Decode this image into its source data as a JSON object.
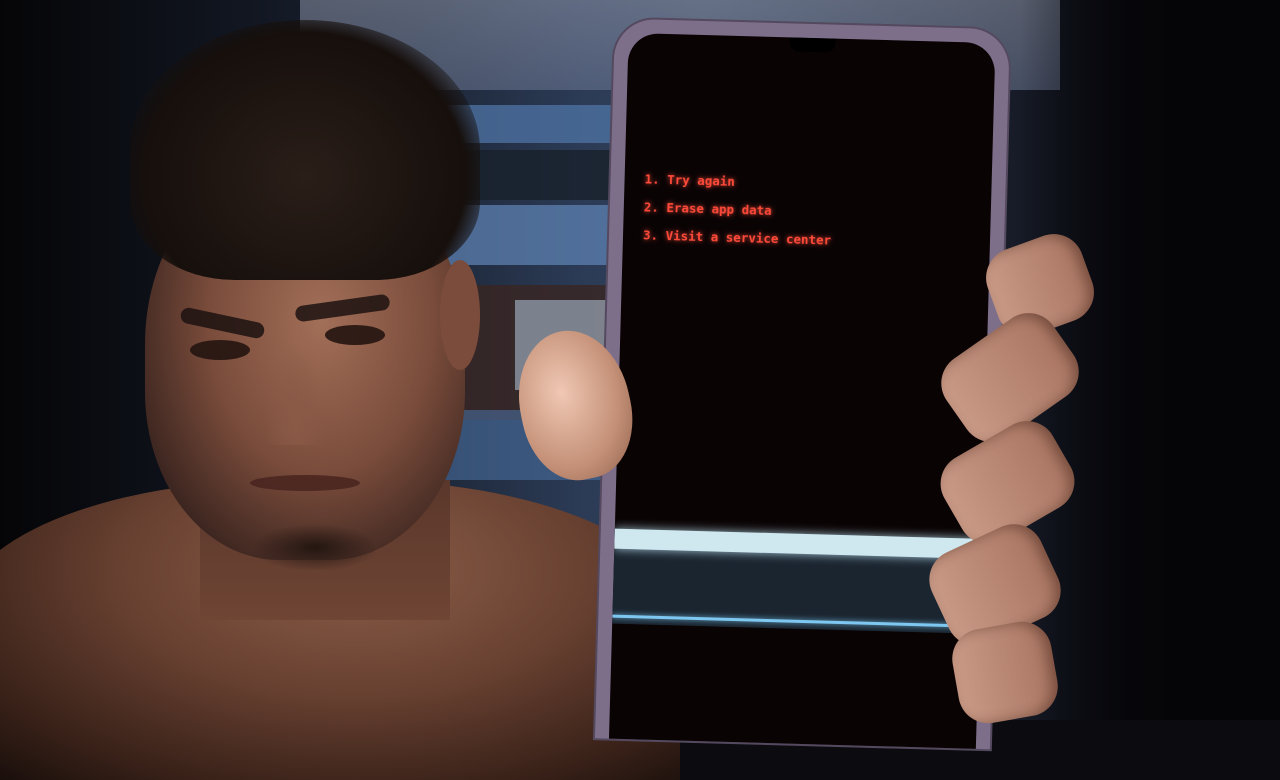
{
  "photo": {
    "subject": "",
    "device_screen": {
      "header_lines": [
        "",
        ""
      ],
      "body_intro": "",
      "steps": [
        {
          "title": "1. Try again",
          "text": ""
        },
        {
          "title": "2. Erase app data",
          "text": ""
        },
        {
          "title": "3. Visit a service center",
          "text": ""
        }
      ],
      "menu_items": [
        "",
        "",
        "",
        ""
      ],
      "footer": ""
    },
    "colors": {
      "screen_text_red": "#ff4a3a",
      "screen_text_header": "#ffd0a0",
      "menu_highlight": "#cfe8f0",
      "menu_separator": "#7ec7f0"
    }
  }
}
